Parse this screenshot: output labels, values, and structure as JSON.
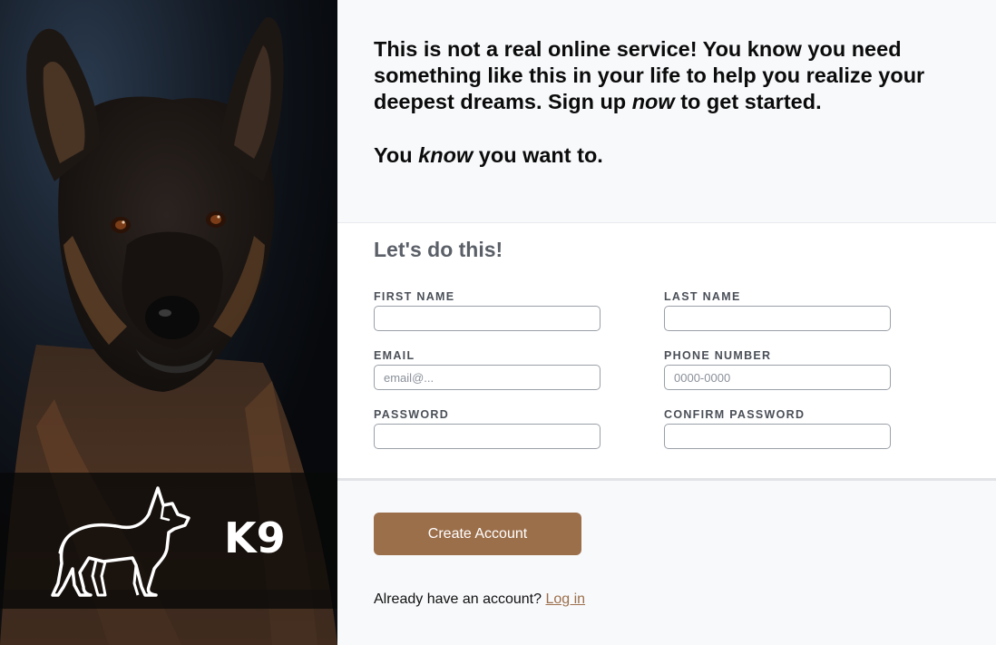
{
  "brand": {
    "name": "K9",
    "logo_icon": "german-shepherd-icon"
  },
  "intro": {
    "line1_start": "This is not a real online service! You know you need something like this in your life to help you realize your deepest dreams. Sign up ",
    "line1_em": "now",
    "line1_end": " to get started.",
    "line2_start": "You ",
    "line2_em": "know",
    "line2_end": " you want to."
  },
  "form": {
    "title": "Let's do this!",
    "first_name": {
      "label": "FIRST NAME",
      "value": "",
      "placeholder": ""
    },
    "last_name": {
      "label": "LAST NAME",
      "value": "",
      "placeholder": ""
    },
    "email": {
      "label": "EMAIL",
      "value": "",
      "placeholder": "email@..."
    },
    "phone": {
      "label": "PHONE NUMBER",
      "value": "",
      "placeholder": "0000-0000"
    },
    "password": {
      "label": "PASSWORD",
      "value": "",
      "placeholder": ""
    },
    "confirm_password": {
      "label": "CONFIRM PASSWORD",
      "value": "",
      "placeholder": ""
    }
  },
  "actions": {
    "create_account": "Create Account",
    "login_prompt": "Already have an account? ",
    "login_link": "Log in"
  },
  "colors": {
    "accent": "#9c6f4b",
    "page_bg": "#f8f9fb",
    "form_bg": "#ffffff",
    "title_gray": "#5b6068"
  }
}
